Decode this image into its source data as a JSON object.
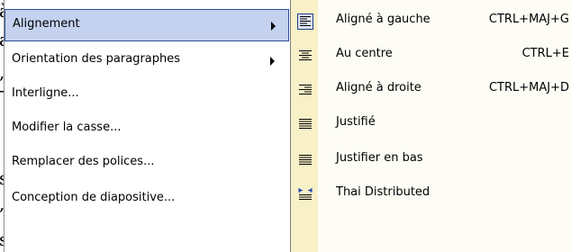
{
  "background_text": [
    "à",
    "a",
    ",",
    "-",
    "s",
    ",",
    "s"
  ],
  "menu": {
    "items": [
      {
        "label": "Alignement",
        "has_submenu": true,
        "selected": true
      },
      {
        "label": "Orientation des paragraphes",
        "has_submenu": true,
        "selected": false
      },
      {
        "label": "Interligne...",
        "has_submenu": false,
        "selected": false
      },
      {
        "label": "Modifier la casse...",
        "has_submenu": false,
        "selected": false
      },
      {
        "label": "Remplacer des polices...",
        "has_submenu": false,
        "selected": false
      },
      {
        "label": "Conception de diapositive...",
        "has_submenu": false,
        "selected": false
      }
    ]
  },
  "submenu": {
    "items": [
      {
        "label": "Aligné à gauche",
        "shortcut": "CTRL+MAJ+G",
        "icon": "align-left-icon",
        "active": true
      },
      {
        "label": "Au centre",
        "shortcut": "CTRL+E",
        "icon": "align-center-icon",
        "active": false
      },
      {
        "label": "Aligné à droite",
        "shortcut": "CTRL+MAJ+D",
        "icon": "align-right-icon",
        "active": false
      },
      {
        "label": "Justifié",
        "shortcut": "",
        "icon": "justify-icon",
        "active": false
      },
      {
        "label": "Justifier en bas",
        "shortcut": "",
        "icon": "justify-low-icon",
        "active": false
      },
      {
        "label": "Thai Distributed",
        "shortcut": "",
        "icon": "thai-distributed-icon",
        "active": false
      }
    ]
  },
  "colors": {
    "selection_fill": "#c4d2f0",
    "selection_border": "#2f4e9a",
    "icon_strip": "#f8f1c8"
  }
}
